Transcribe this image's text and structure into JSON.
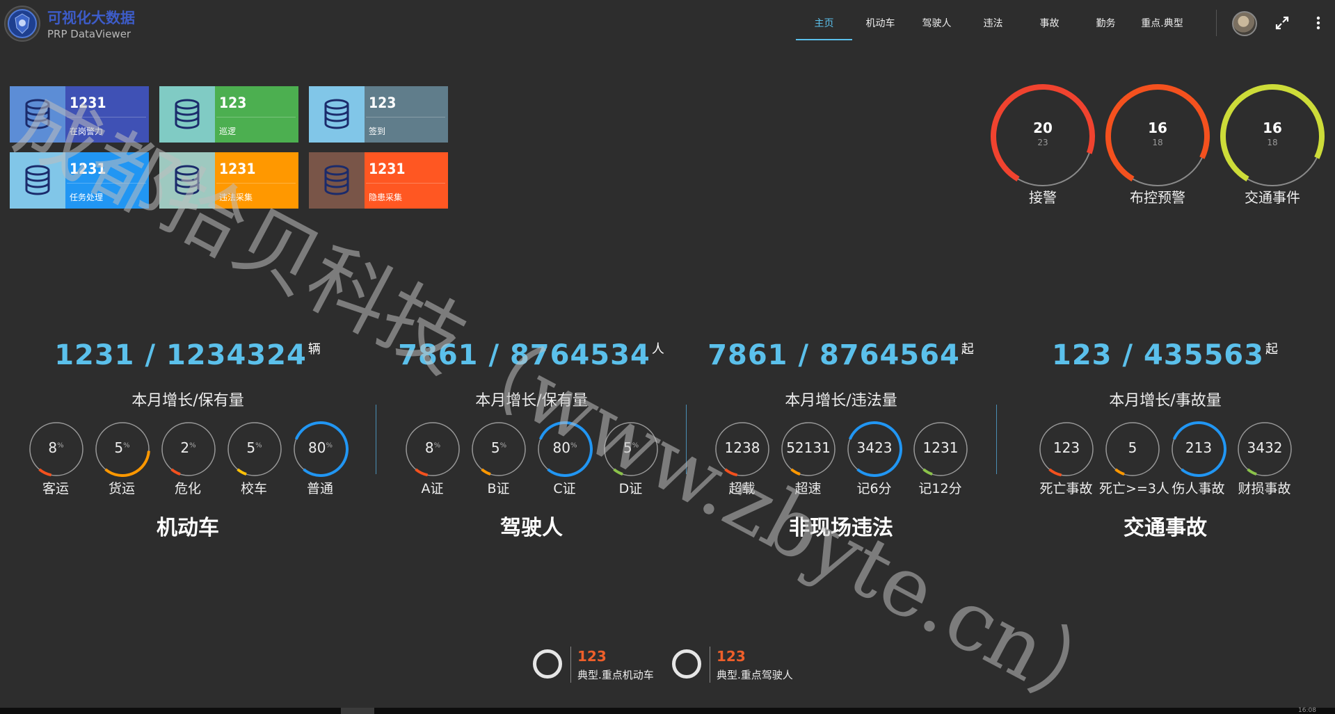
{
  "app": {
    "title": "可视化大数据",
    "subtitle": "PRP DataViewer"
  },
  "nav": [
    {
      "label": "主页",
      "active": true
    },
    {
      "label": "机动车"
    },
    {
      "label": "驾驶人"
    },
    {
      "label": "违法"
    },
    {
      "label": "事故"
    },
    {
      "label": "勤务"
    },
    {
      "label": "重点.典型"
    }
  ],
  "tiles": [
    {
      "value": "1231",
      "label": "在岗警力",
      "bg": "#3f51b5",
      "icon_bg": "#5c8dd6"
    },
    {
      "value": "123",
      "label": "巡逻",
      "bg": "#4caf50",
      "icon_bg": "#80cbc4"
    },
    {
      "value": "123",
      "label": "签到",
      "bg": "#607d8b",
      "icon_bg": "#81c6e8"
    },
    {
      "value": "1231",
      "label": "任务处理",
      "bg": "#2196f3",
      "icon_bg": "#81c6e8"
    },
    {
      "value": "1231",
      "label": "违法采集",
      "bg": "#ff9800",
      "icon_bg": "#9ec9c0"
    },
    {
      "value": "1231",
      "label": "隐患采集",
      "bg": "#ff5722",
      "icon_bg": "#795548"
    }
  ],
  "gauges": [
    {
      "value": "20",
      "max": "23",
      "label": "接警",
      "color": "#f0432f",
      "fraction": 0.87
    },
    {
      "value": "16",
      "max": "18",
      "label": "布控预警",
      "color": "#f4511e",
      "fraction": 0.89
    },
    {
      "value": "16",
      "max": "18",
      "label": "交通事件",
      "color": "#cddc39",
      "fraction": 0.89
    }
  ],
  "sections": [
    {
      "big": "1231 / 1234324",
      "unit": "辆",
      "sub": "本月增长/保有量",
      "title": "机动车",
      "items": [
        {
          "value": "8",
          "pct": true,
          "label": "客运",
          "color": "#f4511e",
          "fraction": 0.08
        },
        {
          "value": "5",
          "pct": true,
          "label": "货运",
          "color": "#ff9800",
          "fraction": 0.35
        },
        {
          "value": "2",
          "pct": true,
          "label": "危化",
          "color": "#f4511e",
          "fraction": 0.02
        },
        {
          "value": "5",
          "pct": true,
          "label": "校车",
          "color": "#ffc107",
          "fraction": 0.05
        },
        {
          "value": "80",
          "pct": true,
          "label": "普通",
          "color": "#2196f3",
          "fraction": 0.8
        }
      ]
    },
    {
      "big": "7861 / 8764534",
      "unit": "人",
      "sub": "本月增长/保有量",
      "title": "驾驶人",
      "items": [
        {
          "value": "8",
          "pct": true,
          "label": "A证",
          "color": "#f4511e",
          "fraction": 0.08
        },
        {
          "value": "5",
          "pct": true,
          "label": "B证",
          "color": "#ff9800",
          "fraction": 0.05
        },
        {
          "value": "80",
          "pct": true,
          "label": "C证",
          "color": "#2196f3",
          "fraction": 0.8
        },
        {
          "value": "5",
          "pct": true,
          "label": "D证",
          "color": "#8bc34a",
          "fraction": 0.05
        }
      ]
    },
    {
      "big": "7861 / 8764564",
      "unit": "起",
      "sub": "本月增长/违法量",
      "title": "非现场违法",
      "items": [
        {
          "value": "1238",
          "pct": false,
          "label": "超载",
          "color": "#f4511e",
          "fraction": 0.08
        },
        {
          "value": "52131",
          "pct": false,
          "label": "超速",
          "color": "#ff9800",
          "fraction": 0.05
        },
        {
          "value": "3423",
          "pct": false,
          "label": "记6分",
          "color": "#2196f3",
          "fraction": 0.8
        },
        {
          "value": "1231",
          "pct": false,
          "label": "记12分",
          "color": "#8bc34a",
          "fraction": 0.05
        }
      ]
    },
    {
      "big": "123 / 435563",
      "unit": "起",
      "sub": "本月增长/事故量",
      "title": "交通事故",
      "items": [
        {
          "value": "123",
          "pct": false,
          "label": "死亡事故",
          "color": "#f4511e",
          "fraction": 0.08
        },
        {
          "value": "5",
          "pct": false,
          "label": "死亡>=3人",
          "color": "#ff9800",
          "fraction": 0.05
        },
        {
          "value": "213",
          "pct": false,
          "label": "伤人事故",
          "color": "#2196f3",
          "fraction": 0.8
        },
        {
          "value": "3432",
          "pct": false,
          "label": "财损事故",
          "color": "#8bc34a",
          "fraction": 0.05
        }
      ]
    }
  ],
  "bottom": [
    {
      "value": "123",
      "label": "典型.重点机动车"
    },
    {
      "value": "123",
      "label": "典型.重点驾驶人"
    }
  ],
  "clock": "16:08",
  "watermark": "成都拾贝科技（www.zbyte.cn）"
}
